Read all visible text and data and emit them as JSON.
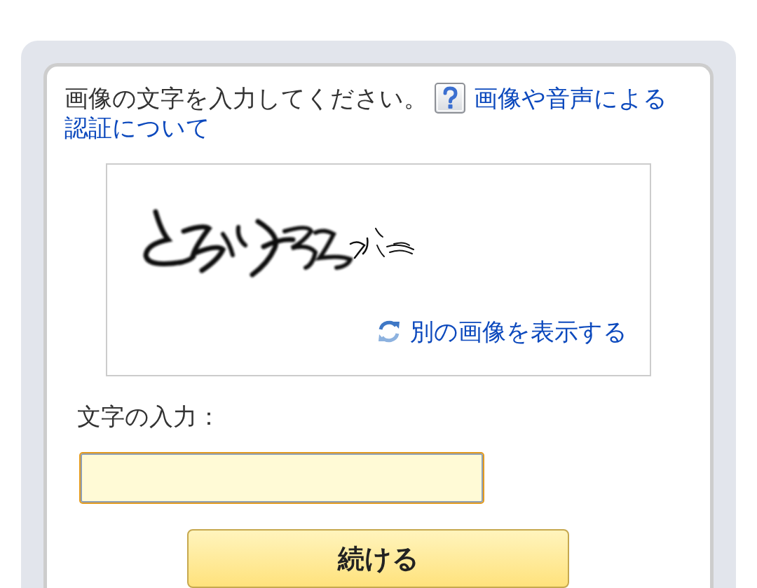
{
  "instructions": {
    "text": "画像の文字を入力してください。",
    "help_link": {
      "lines": [
        "画像や音声による",
        "認証について"
      ]
    }
  },
  "captcha": {
    "refresh_link": "別の画像を表示する"
  },
  "input": {
    "label": "文字の入力：",
    "focused": true
  },
  "submit_button": {
    "label": "続ける"
  }
}
